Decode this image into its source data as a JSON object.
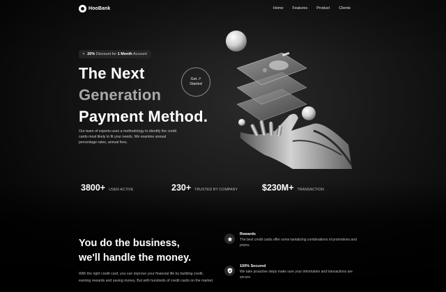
{
  "nav": {
    "logo_text": "HooBank",
    "links": [
      "Home",
      "Features",
      "Product",
      "Clients"
    ]
  },
  "badge": {
    "icon": "percent-icon",
    "percent": "20%",
    "middle": "Discount",
    "for": "for",
    "highlight": "1 Month",
    "suffix": "Account"
  },
  "hero": {
    "line1": "The Next",
    "line2": "Generation",
    "line3": "Payment Method.",
    "cta_line1": "Get ↗",
    "cta_line2": "Started",
    "description": "Our team of experts uses a methodology to identify the credit cards most likely to fit your needs. We examine annual percentage rates, annual fees."
  },
  "stats": [
    {
      "value": "3800+",
      "label": "USER ACTIVE"
    },
    {
      "value": "230+",
      "label": "TRUSTED BY COMPANY"
    },
    {
      "value": "$230M+",
      "label": "TRANSACTION"
    }
  ],
  "section2": {
    "title_line1": "You do the business,",
    "title_line2": "we'll handle the money.",
    "description": "With the right credit card, you can improve your financial life by building credit, earning rewards and saving money. But with hundreds of credit cards on the market.",
    "features": [
      {
        "icon": "star-icon",
        "title": "Rewards",
        "description": "The best credit cards offer some tantalizing combinations of promotions and prizes."
      },
      {
        "icon": "shield-check-icon",
        "title": "100% Secured",
        "description": "We take proactive steps make sure your information and transactions are secure."
      }
    ]
  },
  "colors": {
    "background": "#000000",
    "text_primary": "#ffffff",
    "text_muted": "#a9a9a9",
    "badge_bg": "#232323"
  }
}
